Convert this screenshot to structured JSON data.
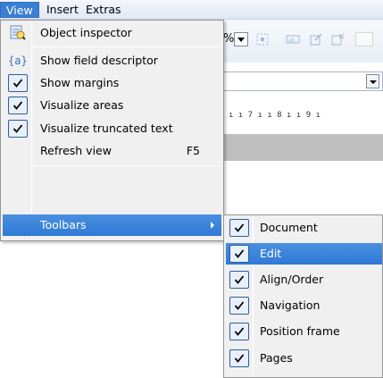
{
  "menubar": {
    "items": [
      {
        "label": "View",
        "active": true
      },
      {
        "label": "Insert",
        "active": false
      },
      {
        "label": "Extras",
        "active": false
      }
    ]
  },
  "background": {
    "toolbar_partial_text": "%",
    "ruler_text": "ı  ı 7 ı  ı 8 ı  ı 9 ı"
  },
  "view_menu": {
    "items": [
      {
        "label": "Object inspector",
        "icon": "object-inspector-icon"
      },
      {
        "label": "Show field descriptor",
        "icon": "field-descriptor-icon",
        "icon_text": "{a}"
      },
      {
        "label": "Show margins",
        "checked": true
      },
      {
        "label": "Visualize areas",
        "checked": true
      },
      {
        "label": "Visualize truncated text",
        "checked": true
      },
      {
        "label": "Refresh view",
        "shortcut": "F5"
      },
      {
        "label": "Toolbars",
        "highlighted": true,
        "has_submenu": true
      }
    ]
  },
  "toolbars_submenu": {
    "items": [
      {
        "label": "Document",
        "checked": true
      },
      {
        "label": "Edit",
        "checked": true,
        "highlighted": true
      },
      {
        "label": "Align/Order",
        "checked": true
      },
      {
        "label": "Navigation",
        "checked": true
      },
      {
        "label": "Position frame",
        "checked": true
      },
      {
        "label": "Pages",
        "checked": true
      }
    ]
  },
  "colors": {
    "highlight": "#3a7fd2",
    "menu_bg": "#f0f0f0",
    "check_border": "#315c9c"
  }
}
